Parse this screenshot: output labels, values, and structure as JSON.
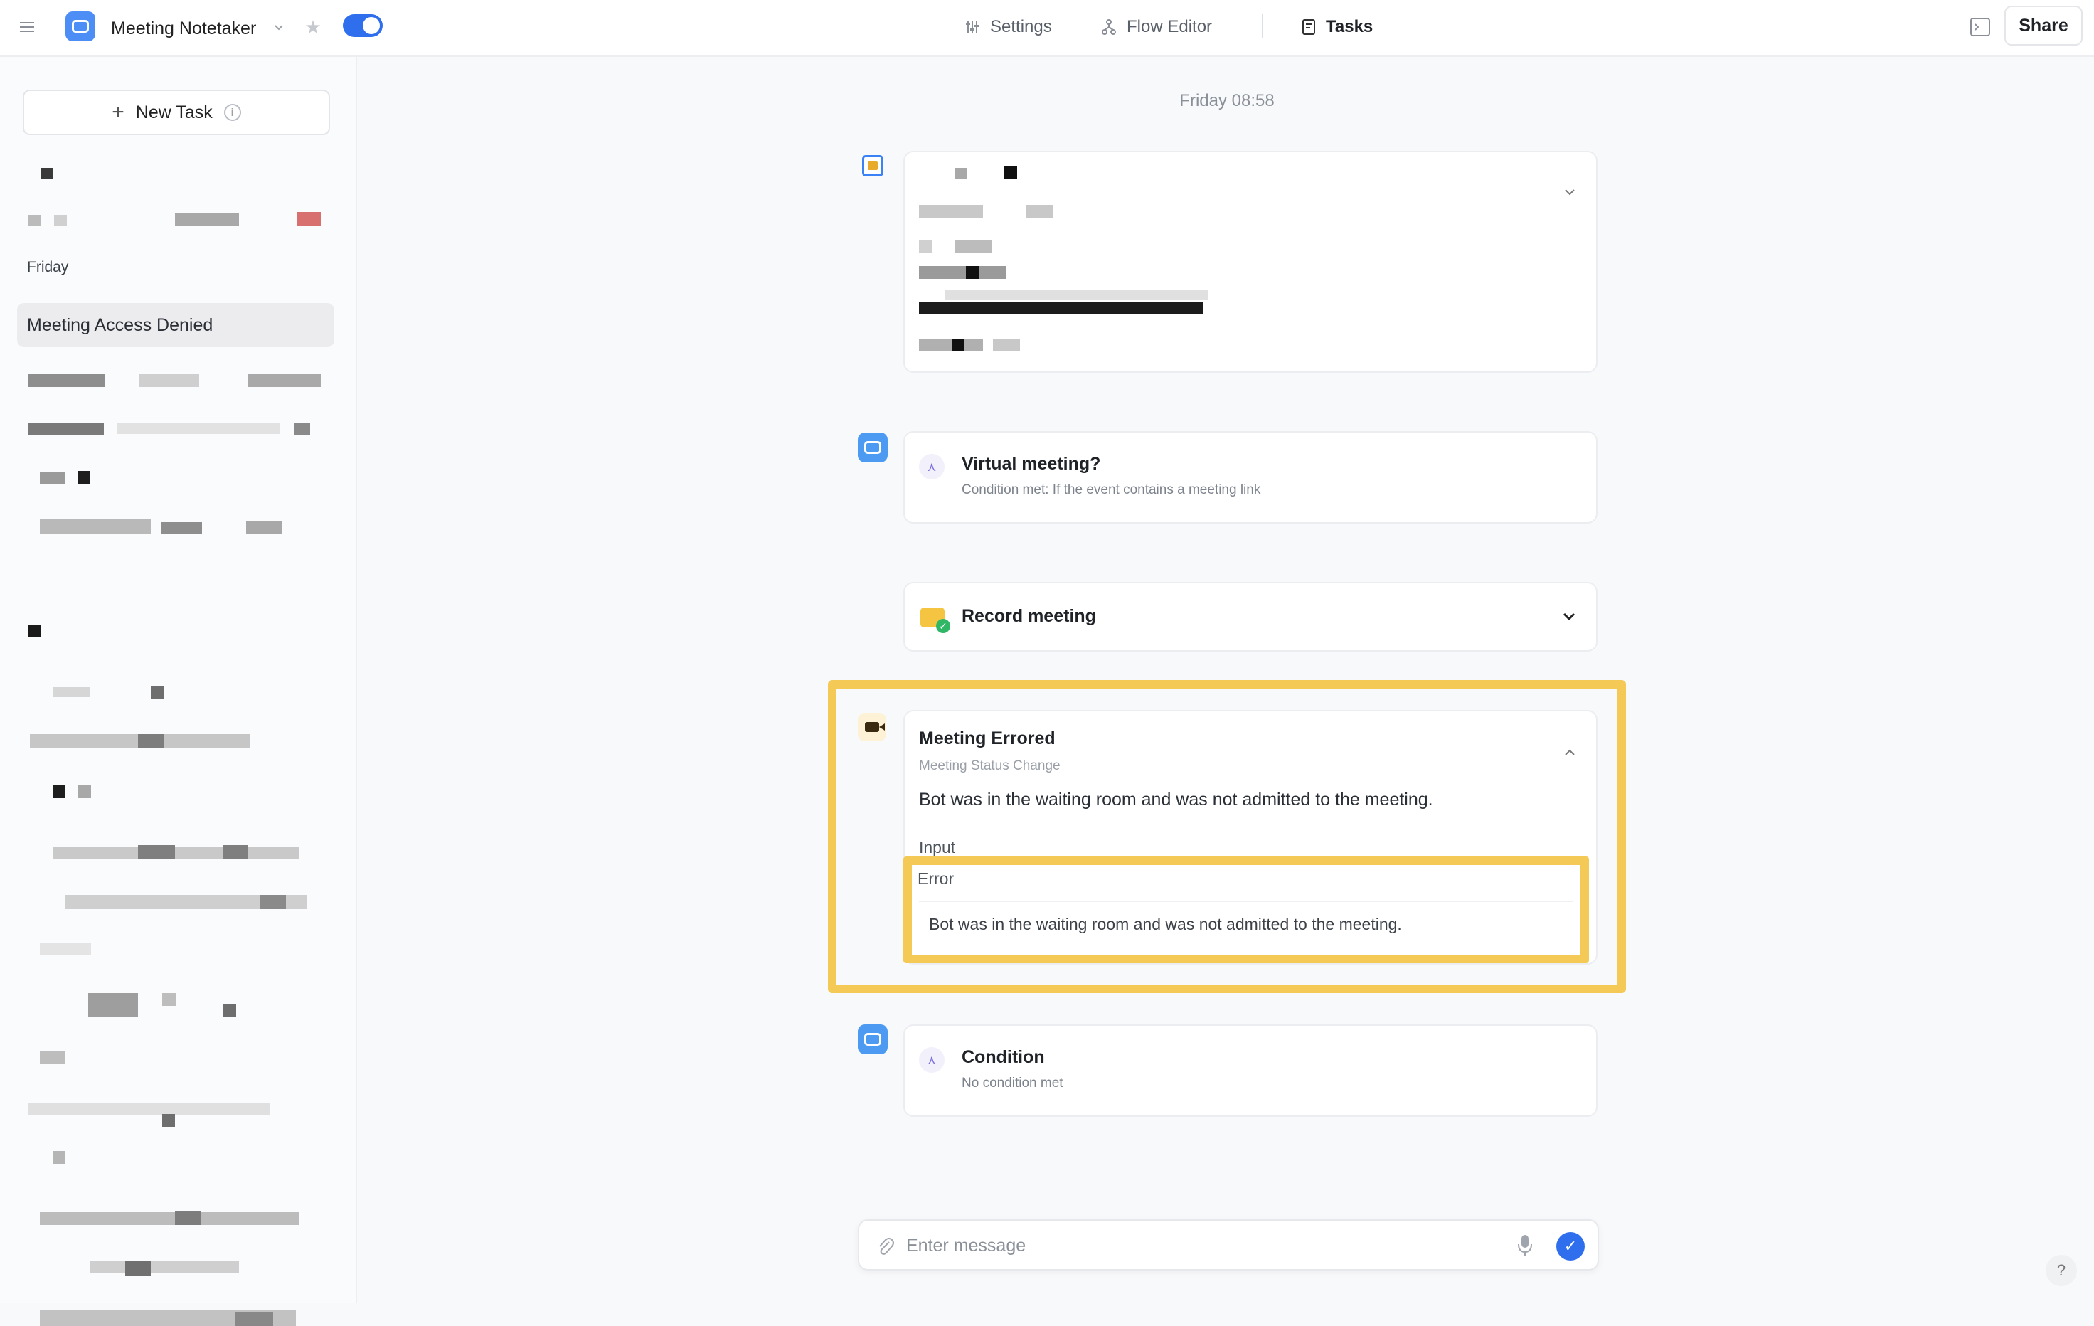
{
  "header": {
    "app_title": "Meeting Notetaker",
    "nav": {
      "settings": "Settings",
      "flow_editor": "Flow Editor",
      "tasks": "Tasks"
    },
    "share": "Share",
    "toggle_on": true,
    "accent_color": "#2f6fed"
  },
  "sidebar": {
    "new_task": "New Task",
    "day_label": "Friday",
    "active_item": "Meeting Access Denied"
  },
  "main": {
    "timestamp": "Friday 08:58",
    "steps": {
      "virtual": {
        "title": "Virtual meeting?",
        "subtitle": "Condition met: If the event contains a meeting link"
      },
      "record": {
        "title": "Record meeting"
      },
      "errored": {
        "title": "Meeting Errored",
        "subtitle": "Meeting Status Change",
        "body": "Bot was in the waiting room and was not admitted to the meeting.",
        "input_label": "Input",
        "error_label": "Error",
        "error_text": "Bot was in the waiting room and was not admitted to the meeting."
      },
      "condition": {
        "title": "Condition",
        "subtitle": "No condition met"
      }
    },
    "highlight_color": "#f5c955"
  },
  "composer": {
    "placeholder": "Enter message"
  },
  "help": "?"
}
